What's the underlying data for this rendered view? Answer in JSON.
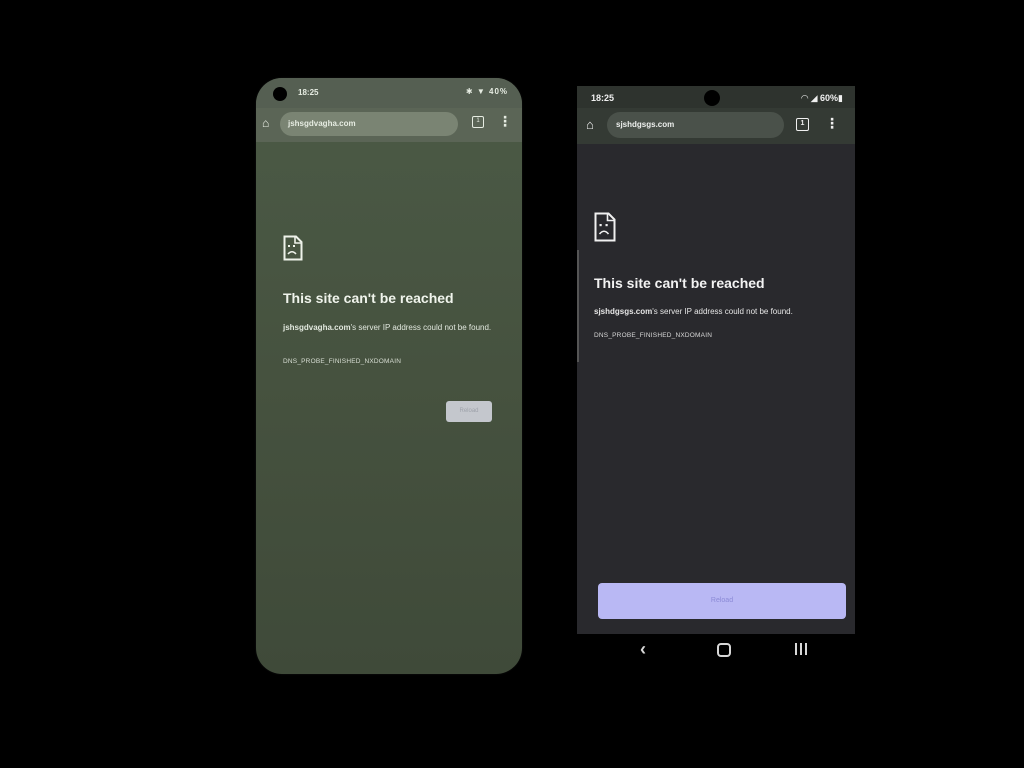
{
  "left_phone": {
    "status": {
      "time": "18:25",
      "icons": "✱ ▼ 40%"
    },
    "toolbar": {
      "url": "jshsgdvagha.com",
      "tab_count": "1"
    },
    "error": {
      "title": "This site can't be reached",
      "host": "jshsgdvagha.com",
      "description": "'s server IP address could not be found.",
      "code": "DNS_PROBE_FINISHED_NXDOMAIN",
      "reload_label": "Reload"
    }
  },
  "right_phone": {
    "status": {
      "time": "18:25",
      "icons": "◠ ◢ 60%▮"
    },
    "toolbar": {
      "url": "sjshdgsgs.com",
      "tab_count": "1"
    },
    "error": {
      "title": "This site can't be reached",
      "host": "sjshdgsgs.com",
      "description": "'s server IP address could not be found.",
      "code": "DNS_PROBE_FINISHED_NXDOMAIN",
      "reload_label": "Reload"
    },
    "nav": {
      "back": "‹"
    }
  },
  "icons": {
    "home": "home-icon",
    "tabs": "tab-switcher-icon",
    "menu": "more-vert-icon",
    "error": "sad-page-icon",
    "back": "back-icon",
    "nav_home": "nav-home-icon",
    "recents": "recents-icon"
  },
  "colors": {
    "left_bg": "#46523f",
    "right_bg": "#29292d",
    "right_reload": "#b9b8f4",
    "left_reload": "#c4c7cd"
  }
}
